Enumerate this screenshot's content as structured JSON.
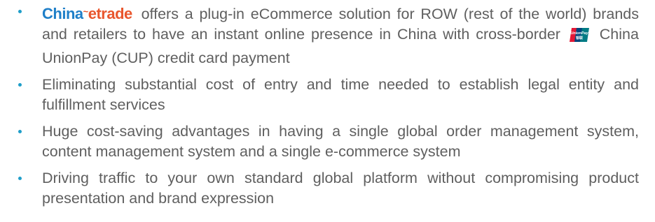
{
  "logo": {
    "part1": "China",
    "separator": "~",
    "part2": "etrade"
  },
  "cup_logo_text": {
    "line1": "UnionPay",
    "line2": "银联"
  },
  "bullets": [
    {
      "before_cup": "offers a plug-in eCommerce solution for ROW (rest of the world) brands and retailers to have an instant online presence in China with cross-border",
      "after_cup": "China UnionPay (CUP) credit card payment"
    },
    {
      "text": "Eliminating substantial cost of entry and time needed to establish legal entity and fulfillment services"
    },
    {
      "text": "Huge cost-saving advantages in having a single global order management system, content management system and a single e-commerce system"
    },
    {
      "text": "Driving traffic to your own standard global platform without compromising product presentation and brand expression"
    }
  ],
  "colors": {
    "text": "#5f5f5f",
    "bullet": "#1f9ec9",
    "logo_blue": "#1f7fc8",
    "logo_orange": "#e9562d"
  }
}
